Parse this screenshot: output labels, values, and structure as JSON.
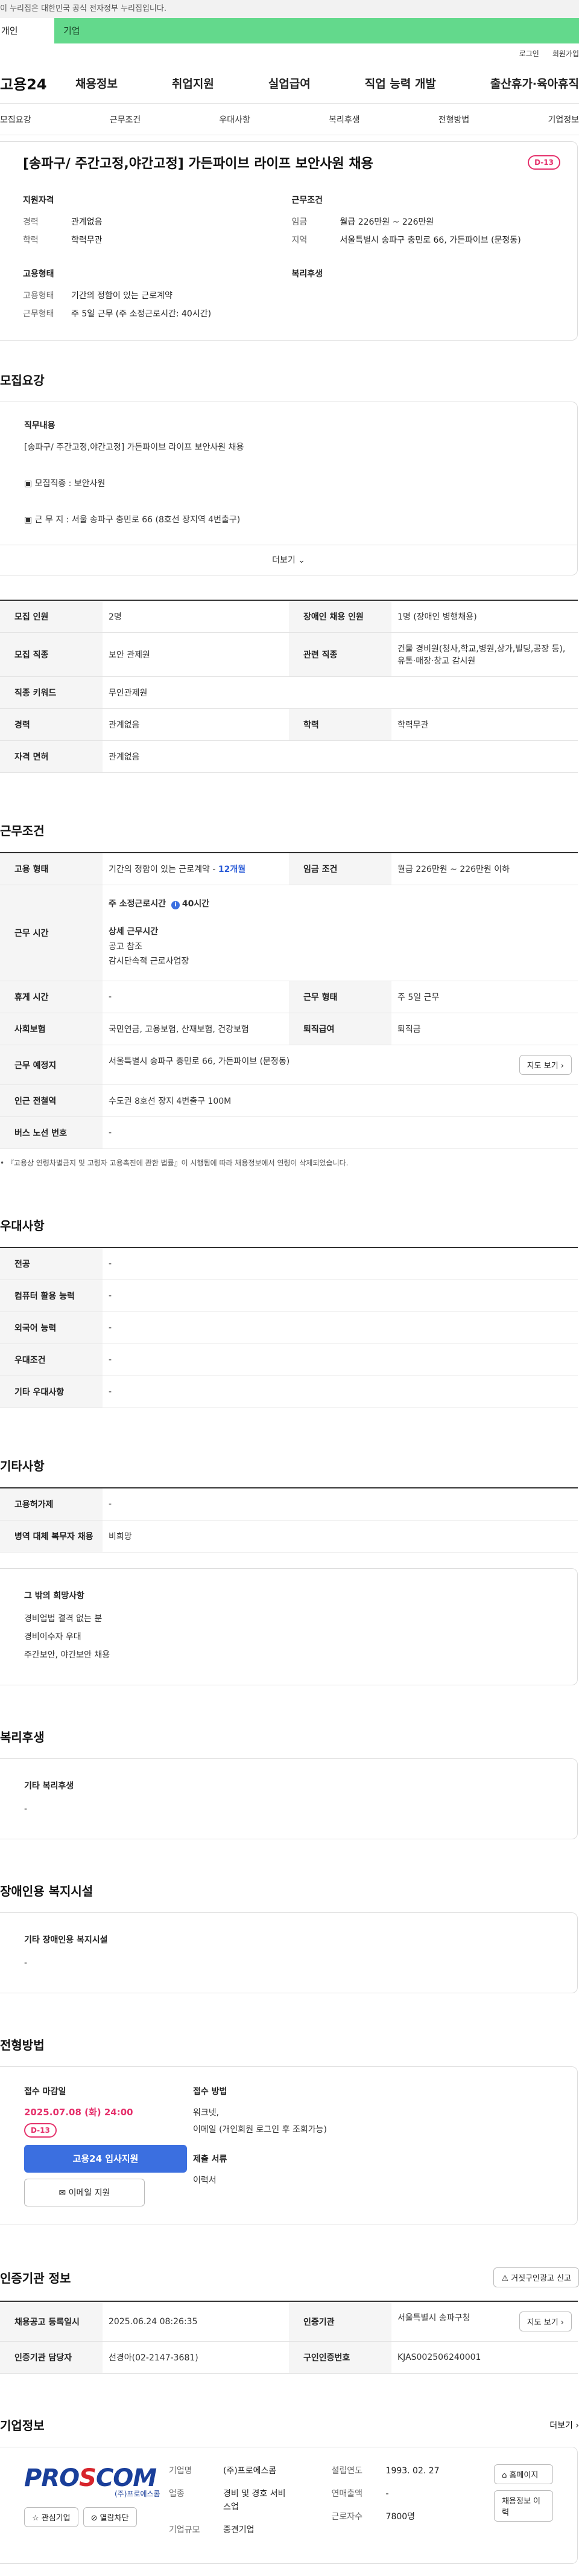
{
  "gov_banner": "이 누리집은 대한민국 공식 전자정부 누리집입니다.",
  "type_tabs": [
    "개인",
    "기업"
  ],
  "util": {
    "login": "로그인",
    "join": "회원가입"
  },
  "logo": "고용24",
  "gnb": [
    "채용정보",
    "취업지원",
    "실업급여",
    "직업 능력 개발",
    "출산휴가·육아휴직"
  ],
  "tabs": [
    "모집요강",
    "근무조건",
    "우대사항",
    "복리후생",
    "전형방법",
    "기업정보"
  ],
  "summary": {
    "title": "[송파구/ 주간고정,야간고정] 가든파이브 라이프 보안사원 채용",
    "dday": "D-13",
    "qual_title": "지원자격",
    "qual": [
      {
        "k": "경력",
        "v": "관계없음"
      },
      {
        "k": "학력",
        "v": "학력무관"
      }
    ],
    "emp_title": "고용형태",
    "emp": [
      {
        "k": "고용형태",
        "v": "기간의 정함이 있는 근로계약"
      },
      {
        "k": "근무형태",
        "v": "주 5일 근무 (주 소정근로시간: 40시간)"
      }
    ],
    "cond_title": "근무조건",
    "cond": [
      {
        "k": "임금",
        "v": "월급 226만원 ~ 226만원"
      },
      {
        "k": "지역",
        "v": "서울특별시 송파구 충민로 66, 가든파이브 (문정동)"
      }
    ],
    "welfare_title": "복리후생"
  },
  "recruit": {
    "title": "모집요강",
    "desc_head": "직무내용",
    "desc_lines": [
      "[송파구/ 주간고정,야간고정] 가든파이브 라이프 보안사원 채용",
      "",
      "▣ 모집직종 : 보안사원",
      "",
      "▣ 근 무 지 :  서울 송파구 충민로 66 (8호선 장지역 4번출구)"
    ],
    "more": "더보기",
    "rows": [
      [
        {
          "k": "모집 인원",
          "v": "2명"
        },
        {
          "k": "장애인 채용 인원",
          "v": "1명 (장애인 병행채용)"
        }
      ],
      [
        {
          "k": "모집 직종",
          "v": "보안 관제원"
        },
        {
          "k": "관련 직종",
          "v": "건물 경비원(청사,학교,병원,상가,빌딩,공장 등), 유통·매장·창고 감시원"
        }
      ],
      [
        {
          "k": "직종 키워드",
          "v": "무인관제원"
        }
      ],
      [
        {
          "k": "경력",
          "v": "관계없음"
        },
        {
          "k": "학력",
          "v": "학력무관"
        }
      ],
      [
        {
          "k": "자격 면허",
          "v": "관계없음"
        }
      ]
    ]
  },
  "work": {
    "title": "근무조건",
    "emp_type_k": "고용 형태",
    "emp_type_v": "기간의 정함이 있는 근로계약 -",
    "emp_type_link": "12개월",
    "wage_k": "임금 조건",
    "wage_v": "월급 226만원 ~ 226만원 이하",
    "hours_k": "근무 시간",
    "hours_main": "주 소정근로시간 ",
    "hours_val": "40시간",
    "hours_detail_head": "상세 근무시간",
    "hours_detail": [
      "공고 참조",
      "감시단속적 근로사업장"
    ],
    "rows": [
      [
        {
          "k": "휴게 시간",
          "v": "-"
        },
        {
          "k": "근무 형태",
          "v": "주 5일 근무"
        }
      ],
      [
        {
          "k": "사회보험",
          "v": "국민연금, 고용보험, 산재보험, 건강보험"
        },
        {
          "k": "퇴직급여",
          "v": "퇴직금"
        }
      ]
    ],
    "place_k": "근무 예정지",
    "place_v": "서울특별시 송파구 충민로 66, 가든파이브 (문정동)",
    "map_btn": "지도 보기 ›",
    "station_k": "인근 전철역",
    "station_v": "수도권 8호선 장지 4번출구 100M",
    "bus_k": "버스 노선 번호",
    "bus_v": "-",
    "note": "• 『고용상 연령차별금지 및 고령자 고용촉진에 관한 법률』이 시행됨에 따라 채용정보에서 연령이 삭제되었습니다."
  },
  "pref": {
    "title": "우대사항",
    "rows": [
      {
        "k": "전공",
        "v": "-"
      },
      {
        "k": "컴퓨터 활용 능력",
        "v": "-"
      },
      {
        "k": "외국어 능력",
        "v": "-"
      },
      {
        "k": "우대조건",
        "v": "-"
      },
      {
        "k": "기타 우대사항",
        "v": "-"
      }
    ]
  },
  "etc": {
    "title": "기타사항",
    "rows": [
      {
        "k": "고용허가제",
        "v": "-"
      },
      {
        "k": "병역 대체 복무자 채용",
        "v": "비희망"
      }
    ],
    "box_head": "그 밖의 희망사항",
    "box_lines": [
      "경비업법 결격 없는 분",
      "경비이수자 우대",
      "주간보안, 야간보안 채용"
    ]
  },
  "welfare": {
    "title": "복리후생",
    "head": "기타 복리후생",
    "value": "-"
  },
  "disabled": {
    "title": "장애인용 복지시설",
    "head": "기타 장애인용 복지시설",
    "value": "-"
  },
  "process": {
    "title": "전형방법",
    "deadline_head": "접수 마감일",
    "deadline": "2025.07.08 (화) 24:00",
    "dday": "D-13",
    "apply_btn": "고용24 입사지원",
    "mail_btn": "✉ 이메일 지원",
    "method_head": "접수 방법",
    "method": [
      "워크넷,",
      "이메일 (개인회원 로그인 후 조회가능)"
    ],
    "docs_head": "제출 서류",
    "docs": "이력서"
  },
  "cert": {
    "title": "인증기관 정보",
    "report_btn": "⚠ 거짓구인광고 신고",
    "rows": [
      [
        {
          "k": "채용공고 등록일시",
          "v": "2025.06.24 08:26:35"
        },
        {
          "k": "인증기관",
          "v": "서울특별시 송파구청"
        }
      ],
      [
        {
          "k": "인증기관 담당자",
          "v": "선경아(02-2147-3681)"
        },
        {
          "k": "구인인증번호",
          "v": "KJAS002506240001"
        }
      ]
    ],
    "map_btn": "지도 보기 ›"
  },
  "company": {
    "title": "기업정보",
    "more": "더보기 ›",
    "logo_main": "PRO",
    "logo_accent": "S",
    "logo_tail": "COM",
    "logo_sub": "(주)프로에스콤",
    "fav_btn": "☆ 관심기업",
    "block_btn": "⊘ 열람차단",
    "col1": [
      {
        "k": "기업명",
        "v": "(주)프로에스콤"
      },
      {
        "k": "업종",
        "v": "경비 및 경호 서비스업"
      },
      {
        "k": "기업규모",
        "v": "중견기업"
      }
    ],
    "col2": [
      {
        "k": "설립연도",
        "v": "1993. 02. 27"
      },
      {
        "k": "연매출액",
        "v": "-"
      },
      {
        "k": "근로자수",
        "v": "7800명"
      }
    ],
    "home_btn": "⌂ 홈페이지",
    "jobs_btn": "채용정보 이력"
  }
}
